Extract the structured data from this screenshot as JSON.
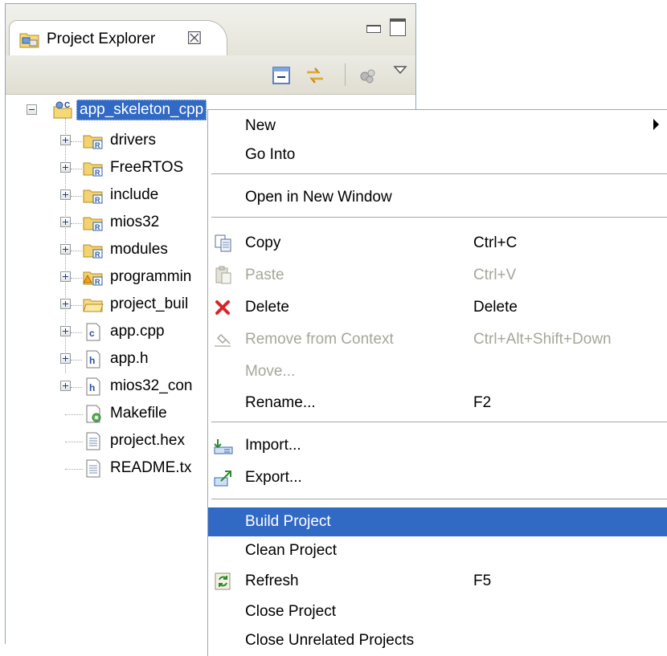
{
  "panel": {
    "title": "Project Explorer",
    "close_glyph": "☒",
    "icons": [
      "project-explorer-icon",
      "close-icon",
      "minimize-icon",
      "maximize-icon"
    ]
  },
  "toolbar": {
    "icons": [
      "collapse-all-icon",
      "link-with-editor-icon",
      "filter-icon",
      "view-menu-icon"
    ]
  },
  "tree": {
    "root": {
      "label": "app_skeleton_cpp",
      "icon": "cpp-project-icon"
    },
    "children": [
      {
        "label": "drivers",
        "icon": "source-folder-icon",
        "expandable": true
      },
      {
        "label": "FreeRTOS",
        "icon": "source-folder-icon",
        "expandable": true
      },
      {
        "label": "include",
        "icon": "source-folder-icon",
        "expandable": true
      },
      {
        "label": "mios32",
        "icon": "source-folder-icon",
        "expandable": true
      },
      {
        "label": "modules",
        "icon": "source-folder-icon",
        "expandable": true
      },
      {
        "label": "programmin",
        "icon": "warning-folder-icon",
        "expandable": true
      },
      {
        "label": "project_buil",
        "icon": "folder-icon",
        "expandable": true
      },
      {
        "label": "app.cpp",
        "icon": "cpp-file-icon",
        "expandable": true
      },
      {
        "label": "app.h",
        "icon": "header-file-icon",
        "expandable": true
      },
      {
        "label": "mios32_con",
        "icon": "header-file-icon",
        "expandable": true
      },
      {
        "label": "Makefile",
        "icon": "makefile-icon",
        "expandable": false
      },
      {
        "label": "project.hex",
        "icon": "text-file-icon",
        "expandable": false
      },
      {
        "label": "README.tx",
        "icon": "text-file-icon",
        "expandable": false
      }
    ]
  },
  "menu": {
    "items": [
      {
        "label": "New",
        "shortcut": "",
        "submenu": true
      },
      {
        "label": "Go Into",
        "shortcut": ""
      },
      {
        "label": "Open in New Window",
        "shortcut": ""
      },
      {
        "label": "Copy",
        "shortcut": "Ctrl+C",
        "icon": "copy-icon"
      },
      {
        "label": "Paste",
        "shortcut": "Ctrl+V",
        "icon": "paste-icon",
        "disabled": true
      },
      {
        "label": "Delete",
        "shortcut": "Delete",
        "icon": "delete-icon"
      },
      {
        "label": "Remove from Context",
        "shortcut": "Ctrl+Alt+Shift+Down",
        "icon": "remove-context-icon",
        "disabled": true
      },
      {
        "label": "Move...",
        "shortcut": "",
        "disabled": true
      },
      {
        "label": "Rename...",
        "shortcut": "F2"
      },
      {
        "label": "Import...",
        "shortcut": "",
        "icon": "import-icon"
      },
      {
        "label": "Export...",
        "shortcut": "",
        "icon": "export-icon"
      },
      {
        "label": "Build Project",
        "shortcut": "",
        "selected": true
      },
      {
        "label": "Clean Project",
        "shortcut": ""
      },
      {
        "label": "Refresh",
        "shortcut": "F5",
        "icon": "refresh-icon"
      },
      {
        "label": "Close Project",
        "shortcut": ""
      },
      {
        "label": "Close Unrelated Projects",
        "shortcut": ""
      }
    ]
  },
  "colors": {
    "selection": "#316ac5",
    "disabled_text": "#a7a69a",
    "panel_border": "#8fa5c2"
  }
}
